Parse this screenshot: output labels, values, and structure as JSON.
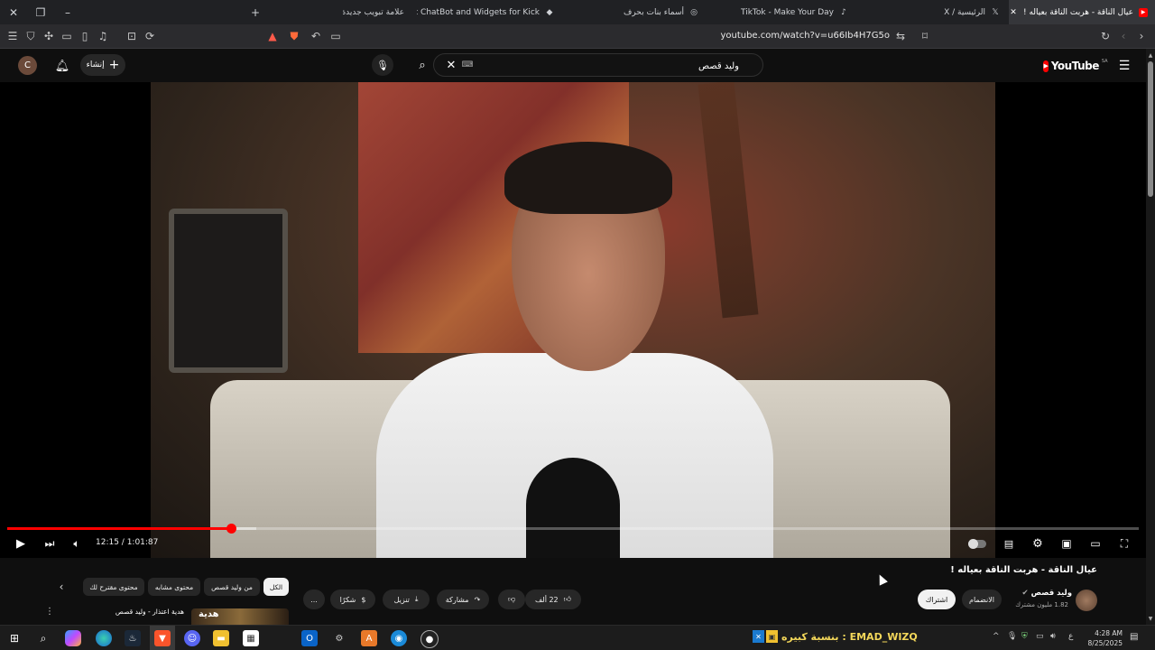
{
  "browser": {
    "tabs": [
      {
        "title": "عيال الناقة - هربت الناقة بعياله !",
        "active": true
      },
      {
        "title": "الرئيسية / X"
      },
      {
        "title": "TikTok - Make Your Day"
      },
      {
        "title": "أسماء بنات بحرف ف"
      },
      {
        "title": "The best ChatBot and Widgets for Kick"
      },
      {
        "title": "علامة تبويب جديدة"
      }
    ],
    "new_tab": "+",
    "url": "youtube.com/watch?v=u66Ib4H7G5o"
  },
  "youtube": {
    "logo": "YouTube",
    "region": "SA",
    "search_value": "وليد قصص",
    "create_label": "إنشاء",
    "avatar_letter": "C"
  },
  "player": {
    "time": "12:15 / 1:01:87",
    "progress_fraction": 0.198,
    "buffered_fraction": 0.22
  },
  "video": {
    "title": "عيال الناقة - هربت الناقة بعياله !",
    "channel_name": "وليد قصص",
    "subscribers": "1.82 مليون مشترك",
    "join_label": "الانضمام",
    "subscribe_label": "اشتراك",
    "likes": "22 ألف",
    "share_label": "مشاركة",
    "download_label": "تنزيل",
    "thanks_label": "شكرًا",
    "more_label": "..."
  },
  "chips": [
    "الكل",
    "من وليد قصص",
    "محتوى مشابه",
    "محتوى مقترح لك"
  ],
  "suggested": {
    "title": "هدية اعتذار - وليد قصص",
    "thumb_text": "هدية"
  },
  "taskbar": {
    "ticker": "بنسبة كبيره : EMAD_WIZQ",
    "time": "4:28 AM",
    "date": "8/25/2025",
    "lang": "ع"
  },
  "colors": {
    "accent": "#ff0000",
    "background": "#0f0f0f"
  }
}
